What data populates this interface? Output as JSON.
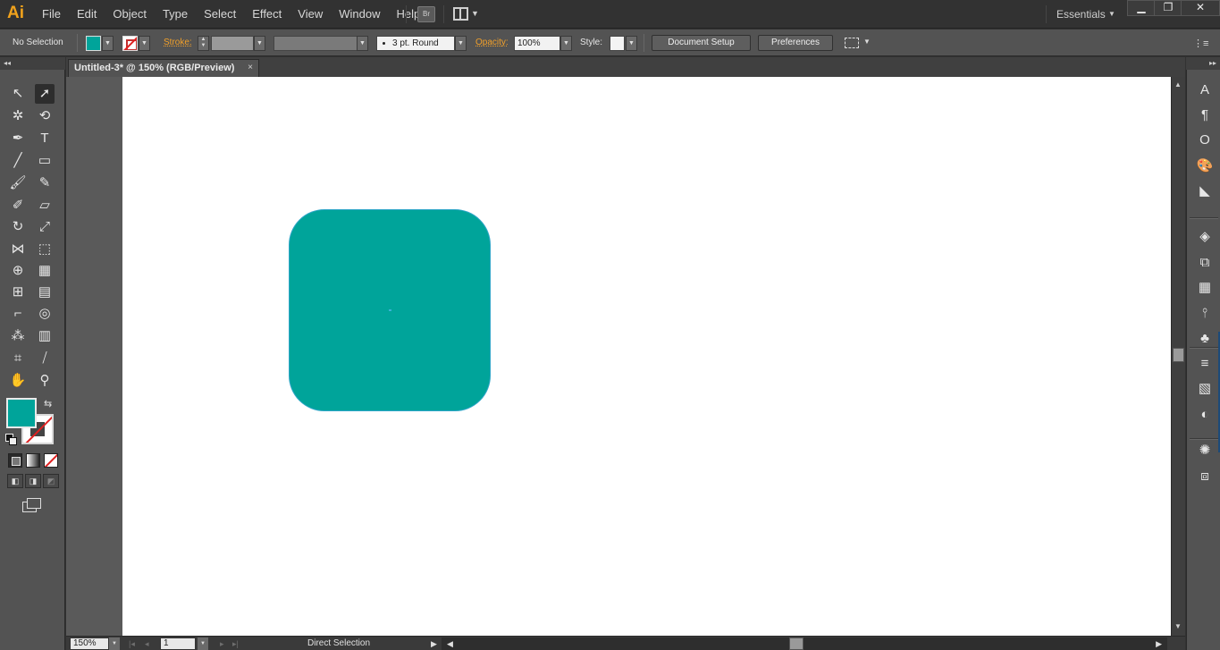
{
  "app": {
    "logo": "Ai",
    "menu": [
      "File",
      "Edit",
      "Object",
      "Type",
      "Select",
      "Effect",
      "View",
      "Window",
      "Help"
    ],
    "bridge_label": "Br",
    "workspace": "Essentials",
    "window_controls": {
      "minimize": "▁",
      "restore": "❐",
      "close": "✕"
    }
  },
  "control_bar": {
    "selection_status": "No Selection",
    "fill_color": "#00a49a",
    "stroke_label": "Stroke:",
    "brush": "3 pt. Round",
    "opacity_label": "Opacity:",
    "opacity": "100%",
    "style_label": "Style:",
    "document_setup": "Document Setup",
    "preferences": "Preferences",
    "dropdown_arrow": "▼",
    "panel_menu_glyph": "⋮≡"
  },
  "document": {
    "tab_title": "Untitled-3* @ 150% (RGB/Preview)",
    "tab_close": "×",
    "shape_fill": "#00a49a",
    "shape_edge_highlight": "#2fa6c8"
  },
  "toolbar": {
    "collapse": "◂◂",
    "tools": [
      {
        "name": "selection-tool",
        "glyph": "↖"
      },
      {
        "name": "direct-selection-tool",
        "glyph": "➚"
      },
      {
        "name": "magic-wand-tool",
        "glyph": "✲"
      },
      {
        "name": "lasso-tool",
        "glyph": "⟲"
      },
      {
        "name": "pen-tool",
        "glyph": "✒"
      },
      {
        "name": "type-tool",
        "glyph": "T"
      },
      {
        "name": "line-segment-tool",
        "glyph": "╱"
      },
      {
        "name": "rectangle-tool",
        "glyph": "▭"
      },
      {
        "name": "paintbrush-tool",
        "glyph": "🖌"
      },
      {
        "name": "pencil-tool",
        "glyph": "✎"
      },
      {
        "name": "blob-brush-tool",
        "glyph": "✐"
      },
      {
        "name": "eraser-tool",
        "glyph": "▱"
      },
      {
        "name": "rotate-tool",
        "glyph": "↻"
      },
      {
        "name": "scale-tool",
        "glyph": "⤢"
      },
      {
        "name": "width-tool",
        "glyph": "⋈"
      },
      {
        "name": "free-transform-tool",
        "glyph": "⬚"
      },
      {
        "name": "shape-builder-tool",
        "glyph": "⊕"
      },
      {
        "name": "perspective-grid-tool",
        "glyph": "▦"
      },
      {
        "name": "mesh-tool",
        "glyph": "⊞"
      },
      {
        "name": "gradient-tool",
        "glyph": "▤"
      },
      {
        "name": "eyedropper-tool",
        "glyph": "⌐"
      },
      {
        "name": "blend-tool",
        "glyph": "◎"
      },
      {
        "name": "symbol-sprayer-tool",
        "glyph": "⁂"
      },
      {
        "name": "column-graph-tool",
        "glyph": "▥"
      },
      {
        "name": "artboard-tool",
        "glyph": "⌗"
      },
      {
        "name": "slice-tool",
        "glyph": "⧸"
      },
      {
        "name": "hand-tool",
        "glyph": "✋"
      },
      {
        "name": "zoom-tool",
        "glyph": "⚲"
      }
    ],
    "swap_glyph": "⇆",
    "draw_mode_glyphs": [
      "◧",
      "◨",
      "◩"
    ]
  },
  "right_dock": {
    "collapse": "▸▸",
    "icons": [
      {
        "name": "character-panel-icon",
        "glyph": "A"
      },
      {
        "name": "paragraph-panel-icon",
        "glyph": "¶"
      },
      {
        "name": "opentype-panel-icon",
        "glyph": "O"
      },
      {
        "name": "color-panel-icon",
        "glyph": "🎨"
      },
      {
        "name": "color-guide-panel-icon",
        "glyph": "◣"
      },
      {
        "name": "layers-panel-icon",
        "glyph": "◈"
      },
      {
        "name": "artboards-panel-icon",
        "glyph": "⧉"
      },
      {
        "name": "swatches-panel-icon",
        "glyph": "▦"
      },
      {
        "name": "brushes-panel-icon",
        "glyph": "⫯"
      },
      {
        "name": "symbols-panel-icon",
        "glyph": "♣"
      },
      {
        "name": "stroke-panel-icon",
        "glyph": "≡"
      },
      {
        "name": "gradient-panel-icon",
        "glyph": "▧"
      },
      {
        "name": "transparency-panel-icon",
        "glyph": "◐"
      },
      {
        "name": "appearance-panel-icon",
        "glyph": "✺"
      },
      {
        "name": "graphic-styles-panel-icon",
        "glyph": "⧈"
      }
    ]
  },
  "status_bar": {
    "zoom": "150%",
    "artboard_number": "1",
    "status_text": "Direct Selection",
    "nav_first": "|◂",
    "nav_prev": "◂",
    "nav_next": "▸",
    "nav_last": "▸|",
    "menu_arrow": "▶",
    "scroll_left": "◀",
    "scroll_right": "▶",
    "scroll_up": "▲",
    "scroll_down": "▼"
  }
}
